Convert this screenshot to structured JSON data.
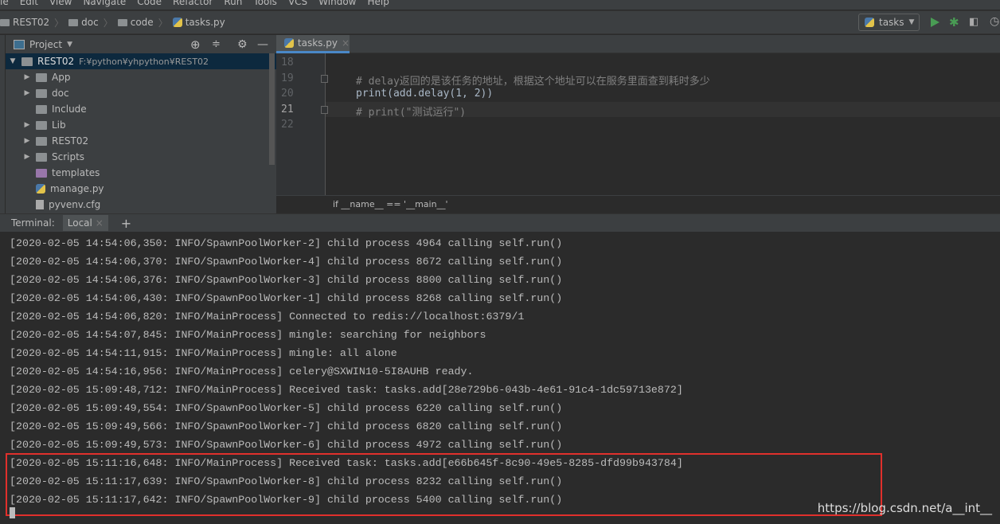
{
  "menu": [
    "le",
    "Edit",
    "View",
    "Navigate",
    "Code",
    "Refactor",
    "Run",
    "Tools",
    "VCS",
    "Window",
    "Help"
  ],
  "breadcrumb": [
    "REST02",
    "doc",
    "code",
    "tasks.py"
  ],
  "run_config": "tasks",
  "project": {
    "title": "Project",
    "root": "REST02",
    "root_path": "F:¥python¥yhpython¥REST02",
    "items": [
      {
        "label": "App",
        "type": "folder",
        "expand": true
      },
      {
        "label": "doc",
        "type": "folder",
        "expand": true
      },
      {
        "label": "Include",
        "type": "folder",
        "expand": false
      },
      {
        "label": "Lib",
        "type": "folder",
        "expand": true
      },
      {
        "label": "REST02",
        "type": "folder",
        "expand": true
      },
      {
        "label": "Scripts",
        "type": "folder",
        "expand": true
      },
      {
        "label": "templates",
        "type": "folder-purple",
        "expand": false
      },
      {
        "label": "manage.py",
        "type": "py",
        "expand": false
      },
      {
        "label": "pyvenv.cfg",
        "type": "file",
        "expand": false
      }
    ]
  },
  "editor": {
    "tab": "tasks.py",
    "lines": [
      {
        "n": "18",
        "code": ""
      },
      {
        "n": "19",
        "code": "# delay返回的是该任务的地址，根据这个地址可以在服务里面查到耗时多少",
        "kind": "comment"
      },
      {
        "n": "20",
        "code": "print(add.delay(1, 2))",
        "kind": "code"
      },
      {
        "n": "21",
        "code": "# print(\"测试运行\")",
        "kind": "comment"
      },
      {
        "n": "22",
        "code": ""
      }
    ],
    "context": "if __name__ == '__main__'"
  },
  "terminal": {
    "label": "Terminal:",
    "tab": "Local",
    "lines": [
      "[2020-02-05 14:54:06,350: INFO/SpawnPoolWorker-2] child process 4964 calling self.run()",
      "[2020-02-05 14:54:06,370: INFO/SpawnPoolWorker-4] child process 8672 calling self.run()",
      "[2020-02-05 14:54:06,376: INFO/SpawnPoolWorker-3] child process 8800 calling self.run()",
      "[2020-02-05 14:54:06,430: INFO/SpawnPoolWorker-1] child process 8268 calling self.run()",
      "[2020-02-05 14:54:06,820: INFO/MainProcess] Connected to redis://localhost:6379/1",
      "[2020-02-05 14:54:07,845: INFO/MainProcess] mingle: searching for neighbors",
      "[2020-02-05 14:54:11,915: INFO/MainProcess] mingle: all alone",
      "[2020-02-05 14:54:16,956: INFO/MainProcess] celery@SXWIN10-5I8AUHB ready.",
      "[2020-02-05 15:09:48,712: INFO/MainProcess] Received task: tasks.add[28e729b6-043b-4e61-91c4-1dc59713e872]",
      "[2020-02-05 15:09:49,554: INFO/SpawnPoolWorker-5] child process 6220 calling self.run()",
      "[2020-02-05 15:09:49,566: INFO/SpawnPoolWorker-7] child process 6820 calling self.run()",
      "[2020-02-05 15:09:49,573: INFO/SpawnPoolWorker-6] child process 4972 calling self.run()",
      "[2020-02-05 15:11:16,648: INFO/MainProcess] Received task: tasks.add[e66b645f-8c90-49e5-8285-dfd99b943784]",
      "[2020-02-05 15:11:17,639: INFO/SpawnPoolWorker-8] child process 8232 calling self.run()",
      "[2020-02-05 15:11:17,642: INFO/SpawnPoolWorker-9] child process 5400 calling self.run()"
    ]
  },
  "watermark": "https://blog.csdn.net/a__int__",
  "colors": {
    "highlight_box": "#e0302c",
    "run_green": "#499c54",
    "selection": "#0d293e"
  }
}
